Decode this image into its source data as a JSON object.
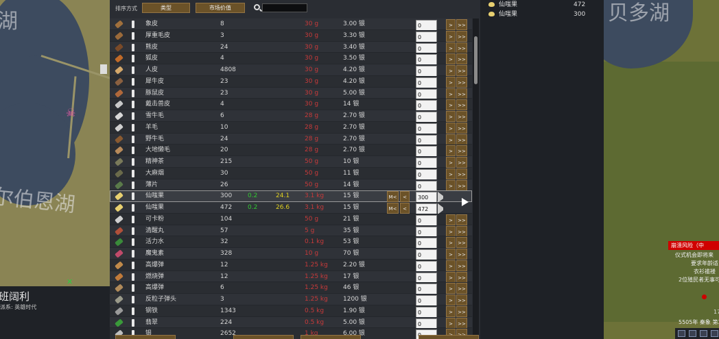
{
  "toolbar": {
    "sort_label": "排序方式",
    "sort_btn_1": "类型",
    "sort_btn_2": "市场价值",
    "search_value": ""
  },
  "map_left": {
    "labels": [
      "湖",
      "尔伯恩湖"
    ],
    "settlement_title": "班阔利",
    "settlement_sub": "派系: 英雄时代"
  },
  "map_right": {
    "label": "贝多湖",
    "alert": "崩溃风险（中",
    "lines": [
      "仪式机会即将来",
      "要求年龄适",
      "衣衫褴褛",
      "2位殖民者无事可"
    ],
    "day": "17",
    "date": "5505年 秦象 第3"
  },
  "side_list": [
    {
      "name": "仙嗤果",
      "count": "472"
    },
    {
      "name": "仙嗤果",
      "count": "300"
    }
  ],
  "items": [
    {
      "icon_color": "#a0703c",
      "name": "象皮",
      "qty": "8",
      "a": "",
      "b": "",
      "mass": "30 g",
      "price": "3.00 银",
      "input": "0",
      "selected": false
    },
    {
      "icon_color": "#9a6a3a",
      "name": "厚重毛皮",
      "qty": "3",
      "a": "",
      "b": "",
      "mass": "30 g",
      "price": "3.30 银",
      "input": "0",
      "selected": false
    },
    {
      "icon_color": "#7a4a28",
      "name": "熊皮",
      "qty": "24",
      "a": "",
      "b": "",
      "mass": "30 g",
      "price": "3.40 银",
      "input": "0",
      "selected": false
    },
    {
      "icon_color": "#c06a28",
      "name": "狐皮",
      "qty": "4",
      "a": "",
      "b": "",
      "mass": "30 g",
      "price": "3.50 银",
      "input": "0",
      "selected": false
    },
    {
      "icon_color": "#d4a86a",
      "name": "人皮",
      "qty": "4808",
      "a": "",
      "b": "",
      "mass": "30 g",
      "price": "4.20 银",
      "input": "0",
      "selected": false
    },
    {
      "icon_color": "#8a6040",
      "name": "犀牛皮",
      "qty": "23",
      "a": "",
      "b": "",
      "mass": "30 g",
      "price": "4.20 银",
      "input": "0",
      "selected": false
    },
    {
      "icon_color": "#b0683a",
      "name": "豚鼠皮",
      "qty": "23",
      "a": "",
      "b": "",
      "mass": "30 g",
      "price": "5.00 银",
      "input": "0",
      "selected": false
    },
    {
      "icon_color": "#c8c8c8",
      "name": "戴击兽皮",
      "qty": "4",
      "a": "",
      "b": "",
      "mass": "30 g",
      "price": "14 银",
      "input": "0",
      "selected": false
    },
    {
      "icon_color": "#d8d8d8",
      "name": "雪牛毛",
      "qty": "6",
      "a": "",
      "b": "",
      "mass": "28 g",
      "price": "2.70 银",
      "input": "0",
      "selected": false
    },
    {
      "icon_color": "#cfcfcf",
      "name": "羊毛",
      "qty": "10",
      "a": "",
      "b": "",
      "mass": "28 g",
      "price": "2.70 银",
      "input": "0",
      "selected": false
    },
    {
      "icon_color": "#8a5a30",
      "name": "野牛毛",
      "qty": "24",
      "a": "",
      "b": "",
      "mass": "28 g",
      "price": "2.70 银",
      "input": "0",
      "selected": false
    },
    {
      "icon_color": "#b88a5a",
      "name": "大地懒毛",
      "qty": "20",
      "a": "",
      "b": "",
      "mass": "28 g",
      "price": "2.70 银",
      "input": "0",
      "selected": false
    },
    {
      "icon_color": "#7a7a5a",
      "name": "精神茶",
      "qty": "215",
      "a": "",
      "b": "",
      "mass": "50 g",
      "price": "10 银",
      "input": "0",
      "selected": false
    },
    {
      "icon_color": "#6a6a4a",
      "name": "大麻烟",
      "qty": "30",
      "a": "",
      "b": "",
      "mass": "50 g",
      "price": "11 银",
      "input": "0",
      "selected": false
    },
    {
      "icon_color": "#5a7a4a",
      "name": "薄片",
      "qty": "26",
      "a": "",
      "b": "",
      "mass": "50 g",
      "price": "14 银",
      "input": "0",
      "selected": false
    },
    {
      "icon_color": "#e8d070",
      "name": "仙嗤果",
      "qty": "300",
      "a": "0.2",
      "b": "24.1",
      "mass": "3.1 kg",
      "price": "15 银",
      "input": "300",
      "selected": true
    },
    {
      "icon_color": "#e8d070",
      "name": "仙嗤果",
      "qty": "472",
      "a": "0.2",
      "b": "26.6",
      "mass": "3.1 kg",
      "price": "15 银",
      "input": "472",
      "selected": false
    },
    {
      "icon_color": "#cfcfcf",
      "name": "可卡粉",
      "qty": "104",
      "a": "",
      "b": "",
      "mass": "50 g",
      "price": "21 银",
      "input": "0",
      "selected": false
    },
    {
      "icon_color": "#b0503a",
      "name": "清醒丸",
      "qty": "57",
      "a": "",
      "b": "",
      "mass": "5 g",
      "price": "35 银",
      "input": "0",
      "selected": false
    },
    {
      "icon_color": "#3a8a3a",
      "name": "活力水",
      "qty": "32",
      "a": "",
      "b": "",
      "mass": "0.1 kg",
      "price": "53 银",
      "input": "0",
      "selected": false
    },
    {
      "icon_color": "#c04a6a",
      "name": "魔鬼素",
      "qty": "328",
      "a": "",
      "b": "",
      "mass": "10 g",
      "price": "70 银",
      "input": "0",
      "selected": false
    },
    {
      "icon_color": "#c08a4a",
      "name": "高爆弹",
      "qty": "12",
      "a": "",
      "b": "",
      "mass": "1.25 kg",
      "price": "2.20 银",
      "input": "0",
      "selected": false
    },
    {
      "icon_color": "#c07a3a",
      "name": "燃烧弹",
      "qty": "12",
      "a": "",
      "b": "",
      "mass": "1.25 kg",
      "price": "17 银",
      "input": "0",
      "selected": false
    },
    {
      "icon_color": "#b08a5a",
      "name": "高爆弹",
      "qty": "6",
      "a": "",
      "b": "",
      "mass": "1.25 kg",
      "price": "46 银",
      "input": "0",
      "selected": false
    },
    {
      "icon_color": "#9a9a8a",
      "name": "反粒子弹头",
      "qty": "3",
      "a": "",
      "b": "",
      "mass": "1.25 kg",
      "price": "1200 银",
      "input": "0",
      "selected": false
    },
    {
      "icon_color": "#9a9a9a",
      "name": "钢铁",
      "qty": "1343",
      "a": "",
      "b": "",
      "mass": "0.5 kg",
      "price": "1.90 银",
      "input": "0",
      "selected": false
    },
    {
      "icon_color": "#3a9a3a",
      "name": "翡翠",
      "qty": "224",
      "a": "",
      "b": "",
      "mass": "0.5 kg",
      "price": "5.00 银",
      "input": "0",
      "selected": false
    },
    {
      "icon_color": "#bfbfbf",
      "name": "银",
      "qty": "2652",
      "a": "",
      "b": "",
      "mass": "1 kg",
      "price": "6.00 银",
      "input": "0",
      "selected": false
    }
  ],
  "buttons": {
    "mlt": "M<",
    "lt": "<",
    "gt": ">",
    "ggt": ">>"
  }
}
